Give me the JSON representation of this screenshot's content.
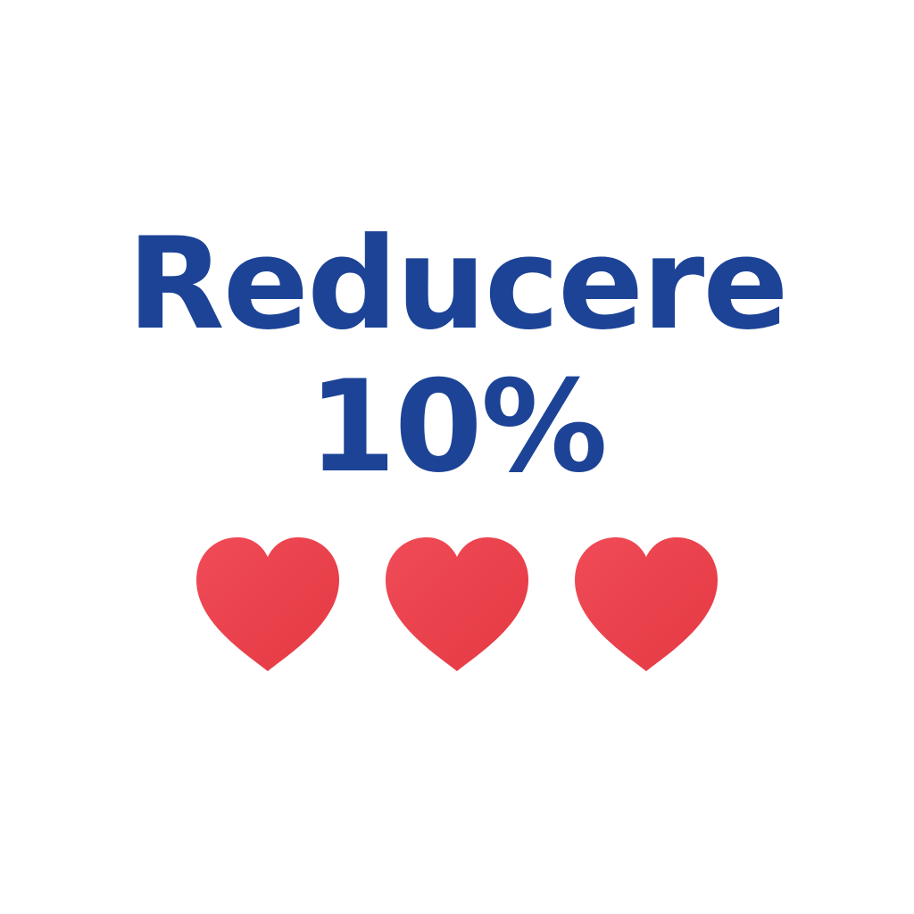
{
  "promo": {
    "headline": "Reducere",
    "discount": "10%"
  },
  "hearts": [
    {
      "icon": "heart-icon"
    },
    {
      "icon": "heart-icon"
    },
    {
      "icon": "heart-icon"
    }
  ],
  "colors": {
    "text": "#1c4396",
    "heart_light": "#ef4b57",
    "heart_dark": "#e53943",
    "background": "#ffffff"
  }
}
